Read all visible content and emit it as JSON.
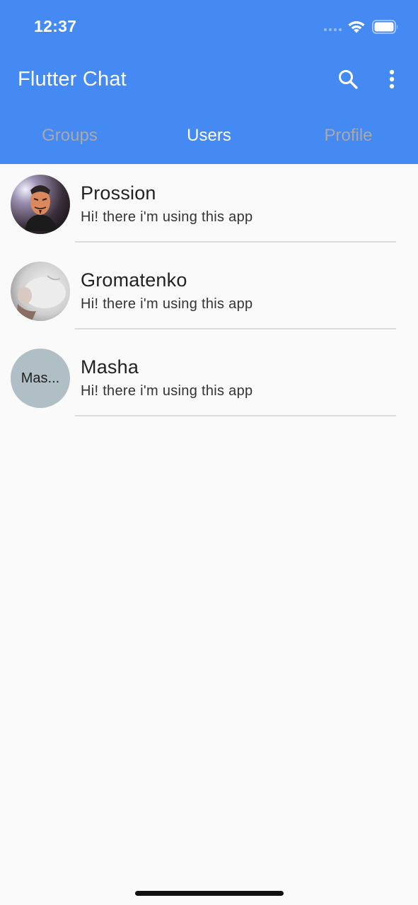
{
  "status_bar": {
    "time": "12:37"
  },
  "app_bar": {
    "title": "Flutter Chat",
    "background": "#4589f3",
    "actions": [
      "search-icon",
      "more-vert-icon"
    ]
  },
  "tabs": [
    {
      "label": "Groups",
      "active": false
    },
    {
      "label": "Users",
      "active": true
    },
    {
      "label": "Profile",
      "active": false
    }
  ],
  "users": [
    {
      "name": "Prossion",
      "status": "Hi! there i'm using this app",
      "avatar": "photo"
    },
    {
      "name": "Gromatenko",
      "status": "Hi! there i'm using this app",
      "avatar": "photo"
    },
    {
      "name": "Masha",
      "status": "Hi! there i'm using this app",
      "avatar_text": "Mas..."
    }
  ]
}
